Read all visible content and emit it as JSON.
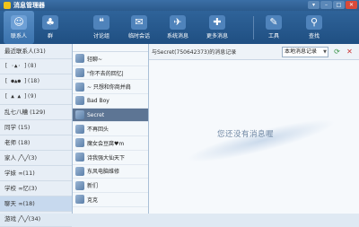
{
  "window": {
    "title": "消息管理器",
    "controls": [
      "▾",
      "–",
      "□",
      "✕"
    ]
  },
  "toolbar": {
    "tools": [
      {
        "label": "联系人",
        "icon": "person-icon"
      },
      {
        "label": "群",
        "icon": "group-icon"
      },
      {
        "label": "讨论组",
        "icon": "discussion-icon"
      },
      {
        "label": "临时会话",
        "icon": "temp-chat-icon"
      },
      {
        "label": "系统消息",
        "icon": "system-message-icon"
      },
      {
        "label": "更多消息",
        "icon": "more-messages-icon"
      },
      {
        "label": "工具",
        "icon": "tools-icon"
      },
      {
        "label": "查找",
        "icon": "search-icon"
      }
    ]
  },
  "groups": [
    "最近联系人(31)",
    "[ ·▲· ](8)",
    "[ ●▲● ](18)",
    "[ ▲ ▲ ](9)",
    "乱七八糟 (129)",
    "同学 (15)",
    "老师 (18)",
    "家人 ╱╲╱(3)",
    "学妹 ∞(11)",
    "学校 ∞忆(3)",
    "聊天 ∞(18)",
    "游戏 ╱╲╱(34)"
  ],
  "contacts": [
    {
      "name": "轻聊~"
    },
    {
      "name": "\"你不去的回忆|"
    },
    {
      "name": "~ 只想和你商并肩"
    },
    {
      "name": "Bad Boy"
    },
    {
      "name": "Secret"
    },
    {
      "name": "不再回头"
    },
    {
      "name": "魔女会豆腐♥m"
    },
    {
      "name": "诗我强大仙天下"
    },
    {
      "name": "东风电脑维修"
    },
    {
      "name": "新们"
    },
    {
      "name": "克克"
    }
  ],
  "chat": {
    "header": "与Secret(750642373)的消息记录",
    "record_select": "本地消息记录",
    "empty_text": "您还没有消息喔"
  }
}
